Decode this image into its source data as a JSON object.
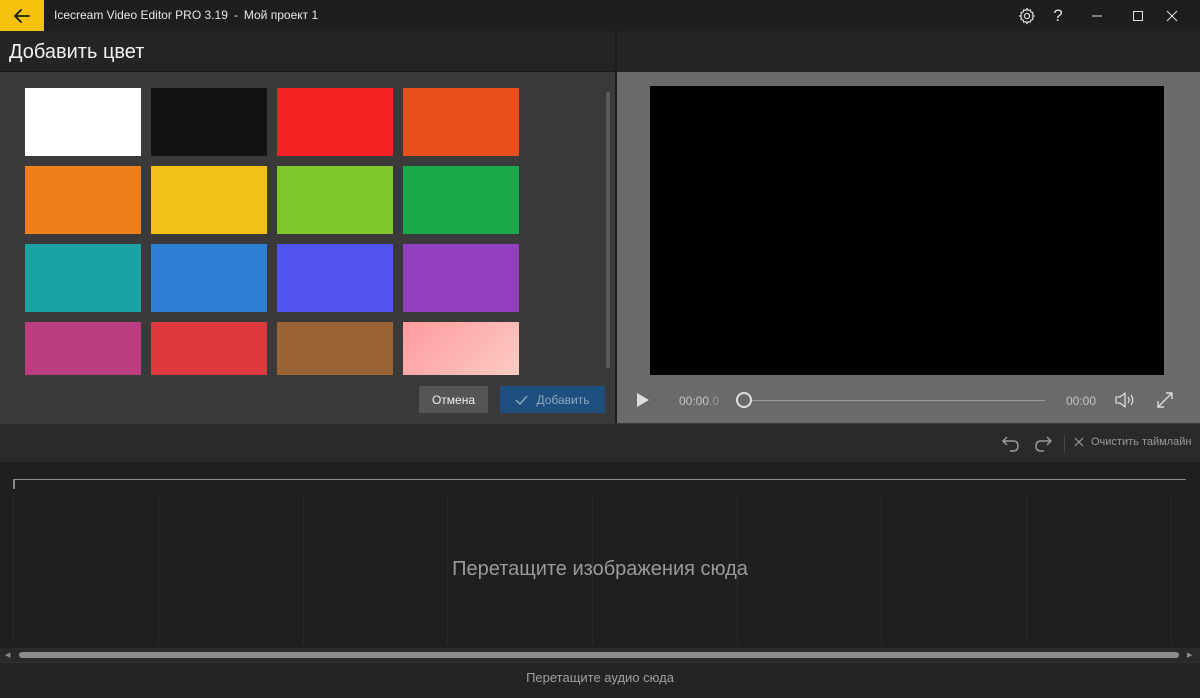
{
  "titlebar": {
    "app_name": "Icecream Video Editor PRO 3.19",
    "separator": "-",
    "project_name": "Мой проект 1",
    "help_label": "?"
  },
  "color_panel": {
    "title": "Добавить цвет",
    "swatches": [
      {
        "name": "white",
        "color": "#ffffff"
      },
      {
        "name": "black",
        "color": "#131313"
      },
      {
        "name": "red",
        "color": "#f42222"
      },
      {
        "name": "orange-red",
        "color": "#e8501e"
      },
      {
        "name": "orange",
        "color": "#ef7f1a"
      },
      {
        "name": "yellow",
        "color": "#f1c119"
      },
      {
        "name": "lime",
        "color": "#7fc62a"
      },
      {
        "name": "green",
        "color": "#1ba84a"
      },
      {
        "name": "teal",
        "color": "#1ba3a3"
      },
      {
        "name": "blue",
        "color": "#2f7fd6"
      },
      {
        "name": "indigo",
        "color": "#4f55ee"
      },
      {
        "name": "purple",
        "color": "#9140c0"
      },
      {
        "name": "magenta",
        "color": "#bb3d80"
      },
      {
        "name": "crimson",
        "color": "#dc383e"
      },
      {
        "name": "brown",
        "color": "#996334"
      },
      {
        "name": "pink-gradient",
        "color": "#ffb6b6",
        "gradient": [
          "#ff9a9e",
          "#fad0c4"
        ]
      }
    ],
    "cancel_label": "Отмена",
    "add_label": "Добавить"
  },
  "preview": {
    "time_current": "00:00",
    "time_current_fraction": ".0",
    "time_total": "00:00"
  },
  "timeline": {
    "clear_label": "Очистить таймлайн",
    "drop_images_hint": "Перетащите изображения сюда",
    "drop_audio_hint": "Перетащите аудио сюда"
  },
  "colors": {
    "accent": "#f4c20d",
    "add_button": "#1f4f7e"
  }
}
